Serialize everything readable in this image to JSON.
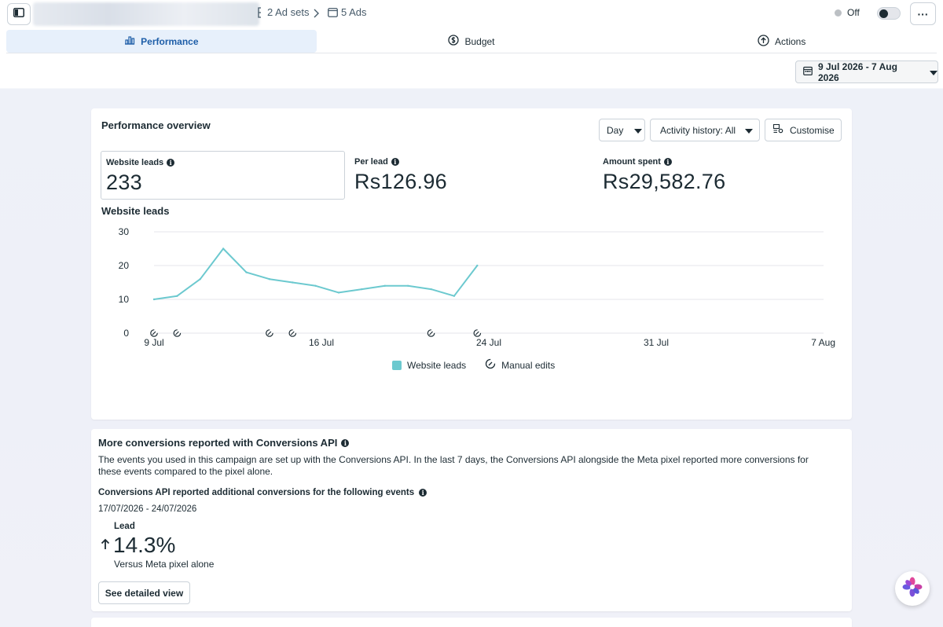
{
  "topbar": {
    "ad_sets": "2 Ad sets",
    "ads": "5 Ads",
    "status": "Off",
    "more": "···"
  },
  "tabs": [
    {
      "label": "Performance",
      "icon": "bar-chart-icon",
      "active": true
    },
    {
      "label": "Budget",
      "icon": "coin-icon",
      "active": false
    },
    {
      "label": "Actions",
      "icon": "upload-icon",
      "active": false
    }
  ],
  "date_range": "9 Jul 2026 - 7 Aug 2026",
  "overview": {
    "title": "Performance overview",
    "day": "Day",
    "activity": "Activity history: All",
    "customise": "Customise",
    "metrics": [
      {
        "label": "Website leads",
        "value": "233"
      },
      {
        "label": "Per lead",
        "value": "Rs126.96"
      },
      {
        "label": "Amount spent",
        "value": "Rs29,582.76"
      }
    ],
    "chart_title": "Website leads",
    "legend": {
      "series": "Website leads",
      "edits": "Manual edits"
    }
  },
  "chart_data": {
    "type": "line",
    "title": "Website leads",
    "x_ticks": [
      "9 Jul",
      "16 Jul",
      "24 Jul",
      "31 Jul",
      "7 Aug"
    ],
    "y_ticks": [
      0,
      10,
      20,
      30
    ],
    "ylim": [
      0,
      30
    ],
    "x_start": "2026-07-09",
    "x_end": "2026-08-07",
    "series": [
      {
        "name": "Website leads",
        "color": "#6cc9cf",
        "x": [
          "2026-07-09",
          "2026-07-10",
          "2026-07-11",
          "2026-07-12",
          "2026-07-13",
          "2026-07-14",
          "2026-07-15",
          "2026-07-16",
          "2026-07-17",
          "2026-07-18",
          "2026-07-19",
          "2026-07-20",
          "2026-07-21",
          "2026-07-22",
          "2026-07-23"
        ],
        "values": [
          10,
          11,
          16,
          25,
          18,
          16,
          15,
          14,
          12,
          13,
          14,
          14,
          13,
          11,
          20
        ]
      }
    ],
    "manual_edits": [
      "2026-07-09",
      "2026-07-10",
      "2026-07-14",
      "2026-07-15",
      "2026-07-21",
      "2026-07-23"
    ],
    "grid": true
  },
  "capi": {
    "title": "More conversions reported with Conversions API",
    "body": "The events you used in this campaign are set up with the Conversions API. In the last 7 days, the Conversions API alongside the Meta pixel reported more conversions for these events compared to the pixel alone.",
    "subtitle": "Conversions API reported additional conversions for the following events",
    "daterange": "17/07/2026 - 24/07/2026",
    "event": "Lead",
    "pct": "14.3%",
    "versus": "Versus Meta pixel alone",
    "button": "See detailed view"
  }
}
